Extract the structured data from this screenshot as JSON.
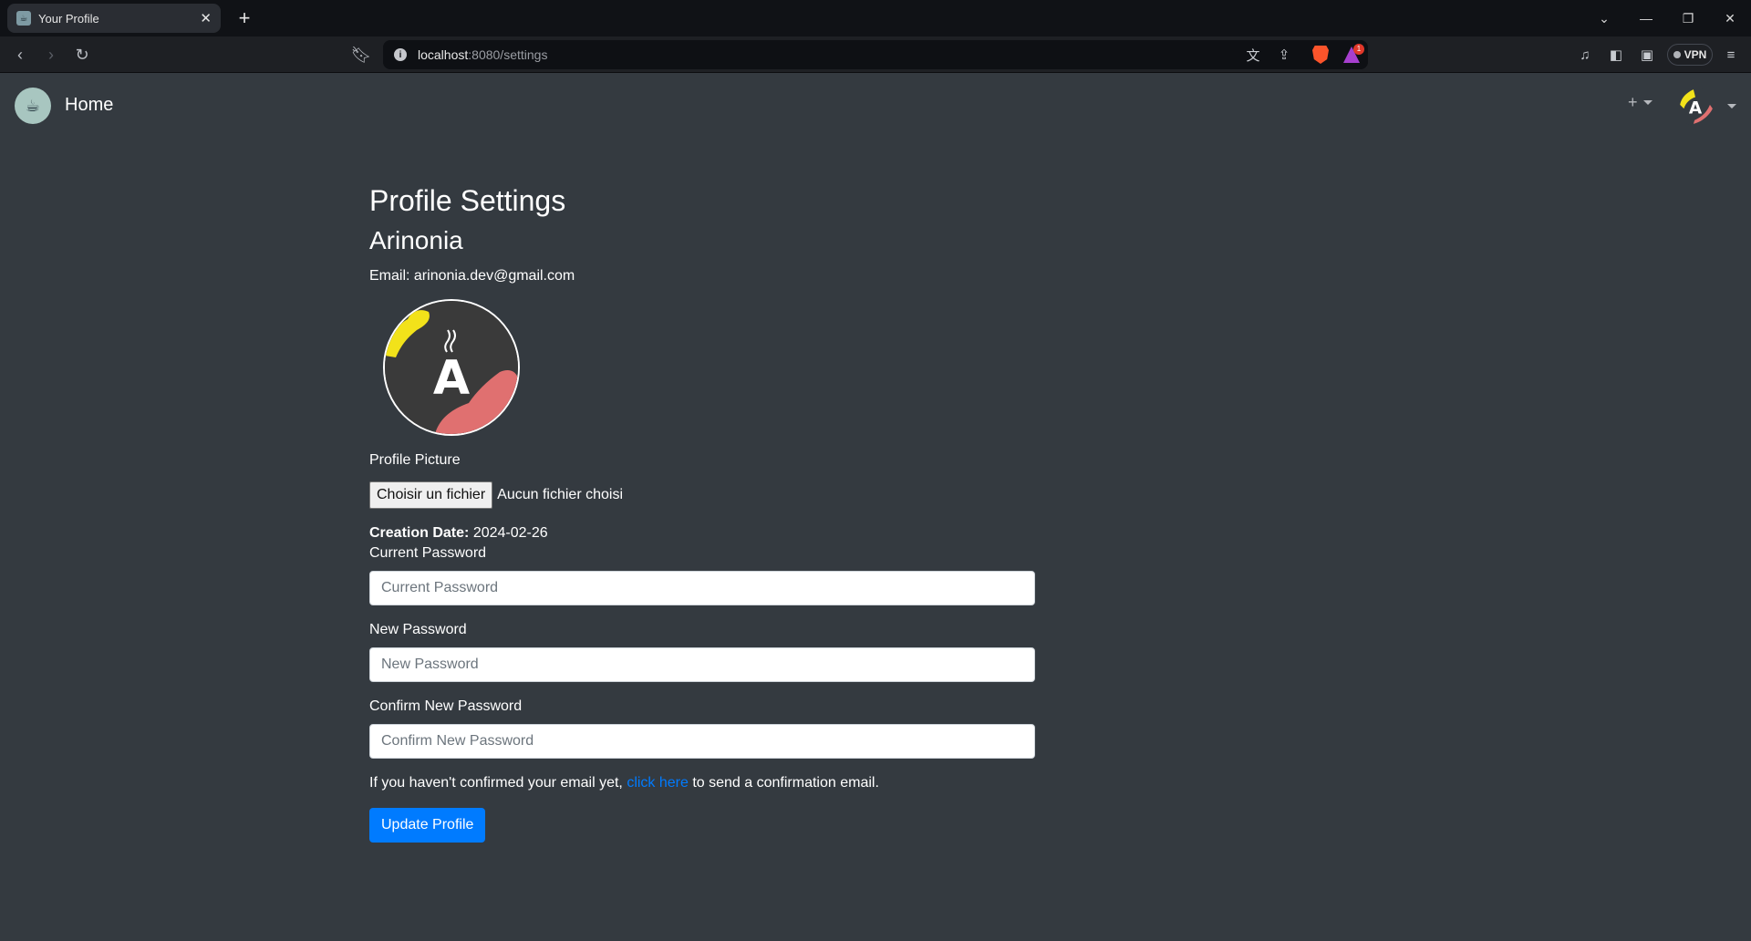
{
  "browser": {
    "tab_title": "Your Profile",
    "url_host": "localhost",
    "url_path": ":8080/settings",
    "vpn_label": "VPN",
    "rewards_badge": "1",
    "accent_brave": "#fb542b"
  },
  "navbar": {
    "brand": "Home",
    "plus": "+"
  },
  "profile": {
    "title": "Profile Settings",
    "username": "Arinonia",
    "email_label": "Email:",
    "email": "arinonia.dev@gmail.com",
    "avatar_letter": "A",
    "picture_label": "Profile Picture",
    "file_button": "Choisir un fichier",
    "file_status": "Aucun fichier choisi",
    "creation_label": "Creation Date:",
    "creation_date": "2024-02-26"
  },
  "form": {
    "current_label": "Current Password",
    "current_placeholder": "Current Password",
    "new_label": "New Password",
    "new_placeholder": "New Password",
    "confirm_label": "Confirm New Password",
    "confirm_placeholder": "Confirm New Password",
    "confirm_text_before": "If you haven't confirmed your email yet,",
    "confirm_link": "click here",
    "confirm_text_after": "to send a confirmation email.",
    "submit": "Update Profile"
  },
  "colors": {
    "page_bg": "#343a40",
    "primary": "#007bff",
    "avatar_yellow": "#f2e21a",
    "avatar_red": "#e07070"
  }
}
